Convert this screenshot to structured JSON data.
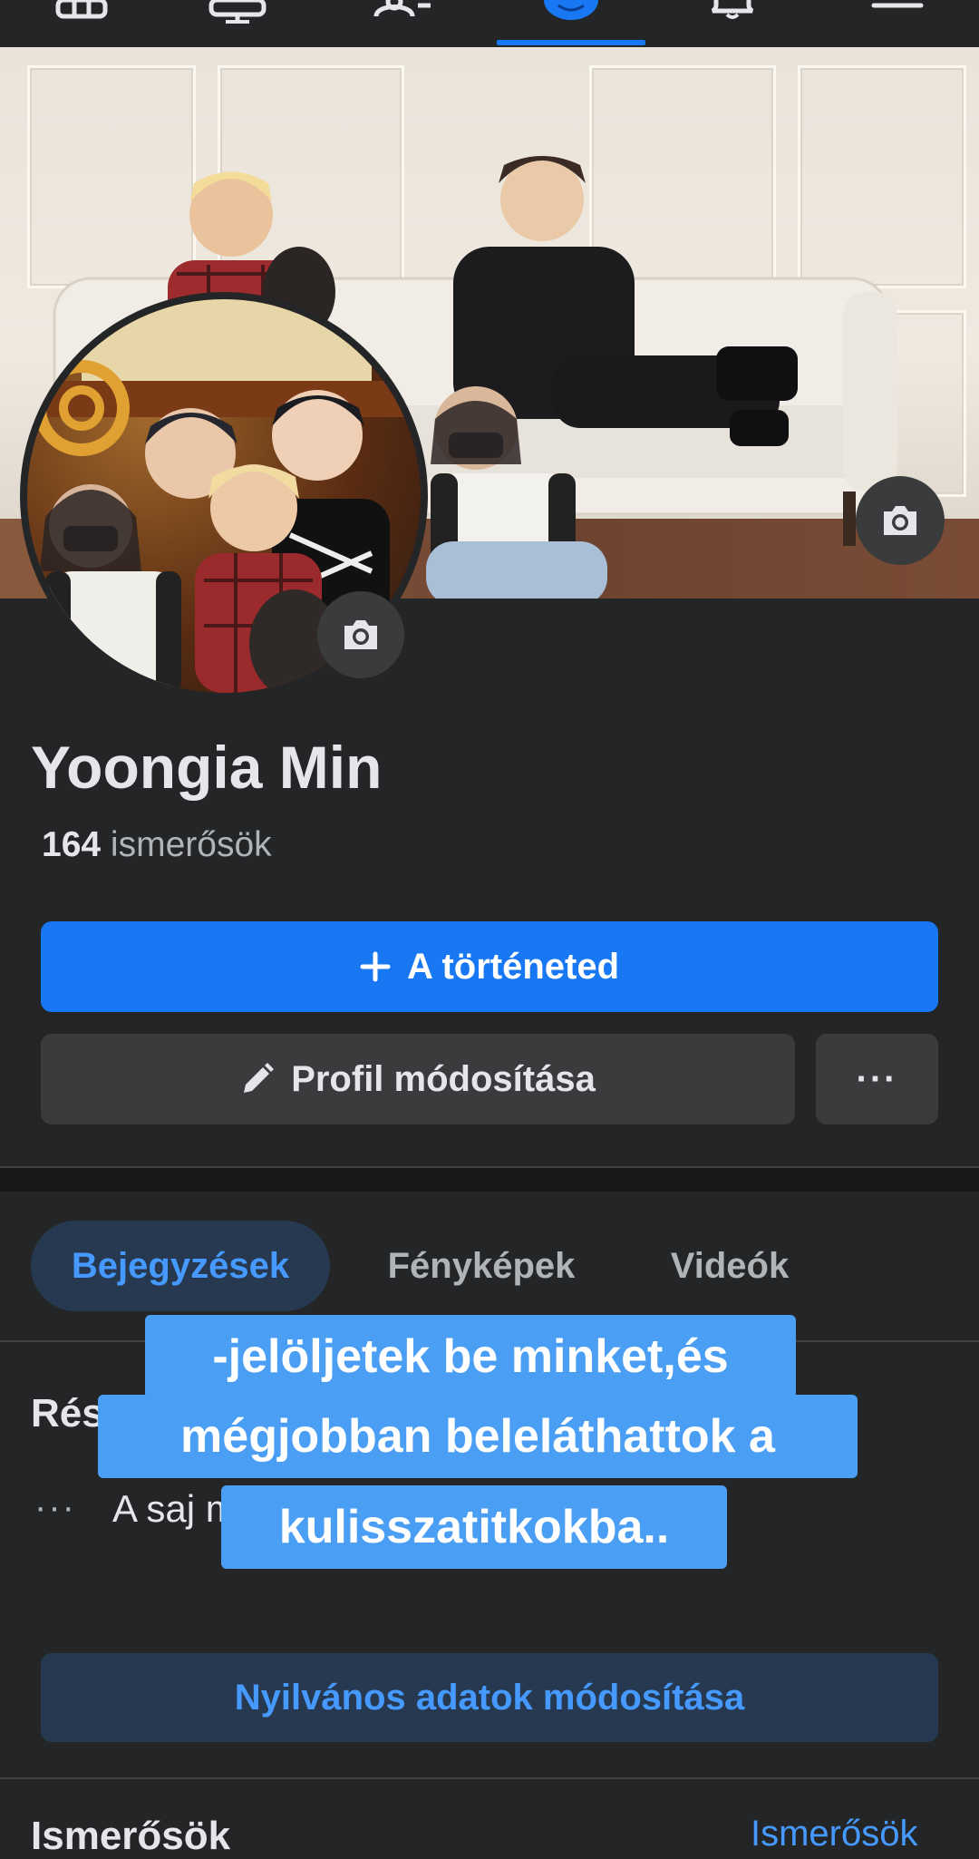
{
  "nav": {
    "icons": [
      "home-icon",
      "watch-icon",
      "friends-icon",
      "profile-icon",
      "notifications-icon",
      "menu-icon"
    ],
    "active_index": 3
  },
  "profile": {
    "name": "Yoongia Min",
    "friends_count": "164",
    "friends_label": "ismerősök"
  },
  "buttons": {
    "story": "A történeted",
    "edit_profile": "Profil módosítása",
    "more": "···",
    "public_details": "Nyilvános adatok módosítása"
  },
  "tabs": [
    {
      "label": "Bejegyzések",
      "active": true
    },
    {
      "label": "Fényképek",
      "active": false
    },
    {
      "label": "Videók",
      "active": false
    }
  ],
  "details": {
    "title": "Rés",
    "dots": "···",
    "text": "A saj megjelenítése"
  },
  "friends_section": {
    "heading": "Ismerősök",
    "link": "Ismerősök"
  },
  "caption": {
    "lines": [
      "-jelöljetek be minket,és",
      "mégjobban beleláthattok a",
      "kulisszatitkokba.."
    ]
  },
  "colors": {
    "background": "#242526",
    "accent": "#1877f2",
    "link": "#4599ff",
    "caption_bg": "#4a9ff5"
  }
}
